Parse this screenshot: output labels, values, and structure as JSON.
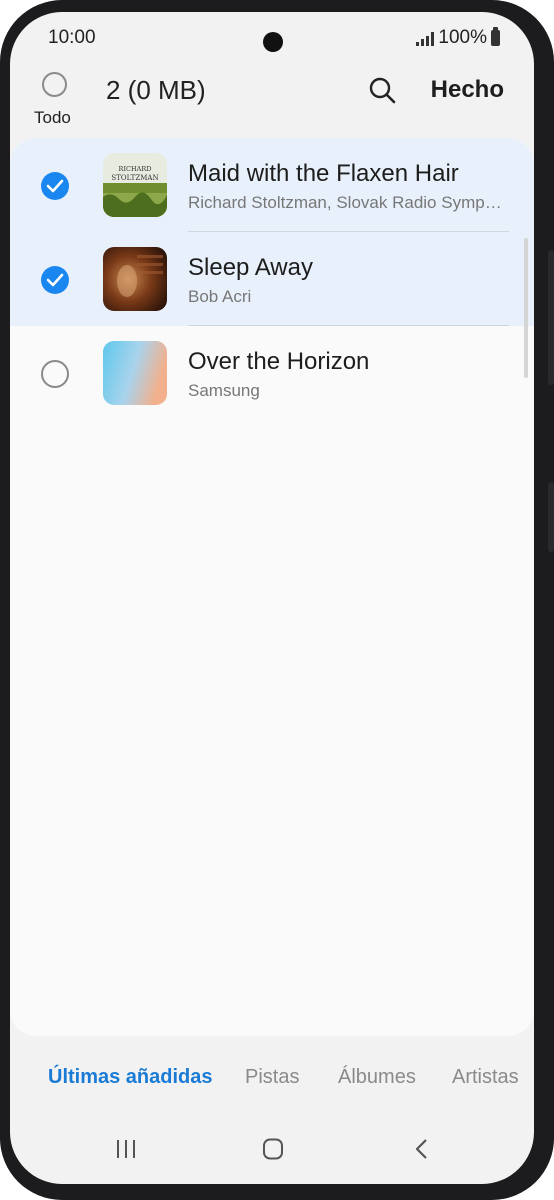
{
  "status_bar": {
    "time": "10:00",
    "battery_text": "100%"
  },
  "toolbar": {
    "select_all_label": "Todo",
    "selection_count": "2 (0 MB)",
    "done_label": "Hecho"
  },
  "tracks": [
    {
      "title": "Maid with the Flaxen Hair",
      "artist": "Richard Stoltzman, Slovak Radio Symphony Orchestra",
      "selected": true,
      "art_text": [
        "RICHARD",
        "STOLTZMAN"
      ]
    },
    {
      "title": "Sleep Away",
      "artist": "Bob Acri",
      "selected": true
    },
    {
      "title": "Over the Horizon",
      "artist": "Samsung",
      "selected": false
    }
  ],
  "tabs": [
    {
      "label": "Últimas añadidas",
      "active": true
    },
    {
      "label": "Pistas",
      "active": false
    },
    {
      "label": "Álbumes",
      "active": false
    },
    {
      "label": "Artistas",
      "active": false
    }
  ],
  "colors": {
    "accent": "#1a86f0",
    "tab_active": "#1a7bd6",
    "selected_row": "#e8f1fb"
  }
}
